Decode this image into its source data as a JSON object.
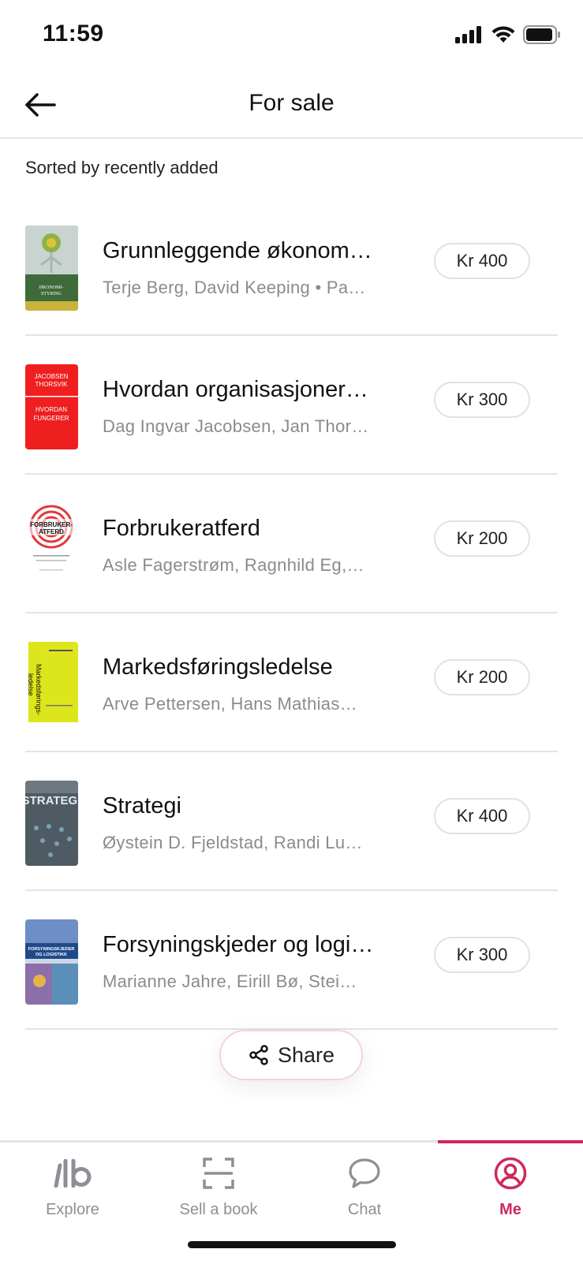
{
  "status_bar": {
    "time": "11:59"
  },
  "header": {
    "title": "For sale"
  },
  "sort_label": "Sorted by recently added",
  "listings": [
    {
      "title": "Grunnleggende økonom…",
      "meta": "Terje Berg, David Keeping • Pa…",
      "price": "Kr 400"
    },
    {
      "title": "Hvordan organisasjoner…",
      "meta": "Dag Ingvar Jacobsen, Jan Thor…",
      "price": "Kr 300"
    },
    {
      "title": "Forbrukeratferd",
      "meta": "Asle Fagerstrøm, Ragnhild Eg,…",
      "price": "Kr 200"
    },
    {
      "title": "Markedsføringsledelse",
      "meta": "Arve Pettersen, Hans Mathias…",
      "price": "Kr 200"
    },
    {
      "title": "Strategi",
      "meta": "Øystein D. Fjeldstad, Randi Lu…",
      "price": "Kr 400"
    },
    {
      "title": "Forsyningskjeder og logi…",
      "meta": "Marianne Jahre, Eirill Bø, Stei…",
      "price": "Kr 300"
    }
  ],
  "covers": {
    "c1": {
      "line1": "ØKONOMI-",
      "line2": "STYRING"
    },
    "c2": {
      "line1": "JACOBSEN",
      "line2": "THORSVIK",
      "line3": "HVORDAN",
      "line4": "FUNGERER"
    },
    "c3": {
      "line1": "FORBRUKER-",
      "line2": "ATFERD"
    },
    "c4": {
      "line1": "Markedsførings-",
      "line2": "ledelse"
    },
    "c5": {
      "line1": "STRATEGI"
    },
    "c6": {
      "line1": "FORSYNINGSKJEDER",
      "line2": "OG LOGISTIKK"
    }
  },
  "share": {
    "label": "Share"
  },
  "tabs": [
    {
      "label": "Explore",
      "icon": "logo-icon"
    },
    {
      "label": "Sell a book",
      "icon": "scan-icon"
    },
    {
      "label": "Chat",
      "icon": "chat-bubble-icon"
    },
    {
      "label": "Me",
      "icon": "profile-icon",
      "active": true
    }
  ],
  "colors": {
    "accent": "#d1275b",
    "muted": "#8e8e96",
    "divider": "#e4e4e4"
  }
}
